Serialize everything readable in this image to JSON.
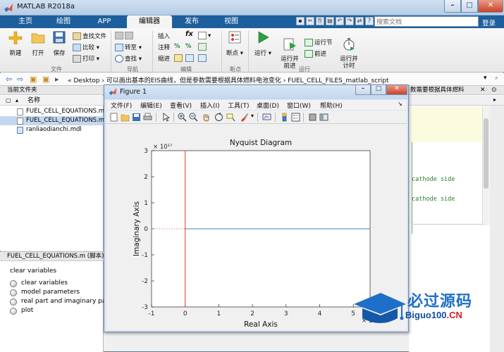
{
  "window": {
    "title": "MATLAB R2018a"
  },
  "tabs": [
    "主页",
    "绘图",
    "APP",
    "编辑器",
    "发布",
    "视图"
  ],
  "search": {
    "placeholder": "搜索文档"
  },
  "login_label": "登录",
  "ribbon": {
    "file": {
      "new": "新建",
      "open": "打开",
      "save": "保存",
      "find_files": "查找文件",
      "compare": "比较",
      "print": "打印",
      "group": "文件"
    },
    "navigate": {
      "goto": "转至",
      "find": "查找",
      "group": "导航"
    },
    "edit": {
      "insert": "插入",
      "comment": "注释",
      "indent": "缩进",
      "fx": "fx",
      "group": "编辑"
    },
    "breakpoints": {
      "label": "断点",
      "group": "断点"
    },
    "run": {
      "run": "运行",
      "run_advance": "运行并\n前进",
      "run_section": "运行节",
      "advance": "前进",
      "run_time": "运行并\n计时",
      "group": "运行"
    }
  },
  "path": {
    "text": "«  Desktop  ›  可以画出基本的EIS曲线，但是参数需要根据具体燃料电池变化  ›  FUEL_CELL_FILES_matlab_script"
  },
  "folder_panel": {
    "title": "当前文件夹",
    "column_name": "名称",
    "files": [
      {
        "name": "FUEL_CELL_EQUATIONS.m",
        "type": "m",
        "selected": false
      },
      {
        "name": "FUEL_CELL_EQUATIONS.m",
        "type": "m",
        "selected": true
      },
      {
        "name": "ranliaodianchi.mdl",
        "type": "mdl",
        "selected": false
      }
    ]
  },
  "details_panel": {
    "title": "FUEL_CELL_EQUATIONS.m  (脚本)",
    "first_line": "clear variables",
    "cells": [
      "clear variables",
      "model parameters",
      "real part and imaginary pa",
      "plot"
    ]
  },
  "editor": {
    "header": "数需要根据具体燃料",
    "code": [
      "cathode side",
      "cathode side"
    ]
  },
  "figure": {
    "title": "Figure 1",
    "menu": [
      "文件(F)",
      "编辑(E)",
      "查看(V)",
      "插入(I)",
      "工具(T)",
      "桌面(D)",
      "窗口(W)",
      "帮助(H)"
    ]
  },
  "chart_data": {
    "type": "line",
    "title": "Nyquist Diagram",
    "xlabel": "Real Axis",
    "ylabel": "Imaginary Axis",
    "x_exponent": "× 10¹⁶",
    "y_exponent": "× 10¹⁷",
    "xlim": [
      -1,
      5.5
    ],
    "ylim": [
      -3,
      3
    ],
    "xticks": [
      -1,
      0,
      1,
      2,
      3,
      4,
      5
    ],
    "yticks": [
      -3,
      -2,
      -1,
      0,
      1,
      2,
      3
    ],
    "series": [
      {
        "color": "#d9512c",
        "points": [
          [
            0,
            -3
          ],
          [
            0,
            3
          ]
        ]
      },
      {
        "color": "#3b86c6",
        "points": [
          [
            0,
            0
          ],
          [
            5.5,
            0
          ]
        ]
      }
    ],
    "reference_line": {
      "style": "dotted",
      "color": "#d96a6a",
      "points": [
        [
          -1,
          0
        ],
        [
          0,
          0
        ]
      ]
    }
  },
  "watermark": {
    "cn": "必过源码",
    "en": "Biguo100",
    "domain": ".CN"
  },
  "colors": {
    "ribbon_blue": "#1d5f9c",
    "accent": "#1e6fc8"
  }
}
